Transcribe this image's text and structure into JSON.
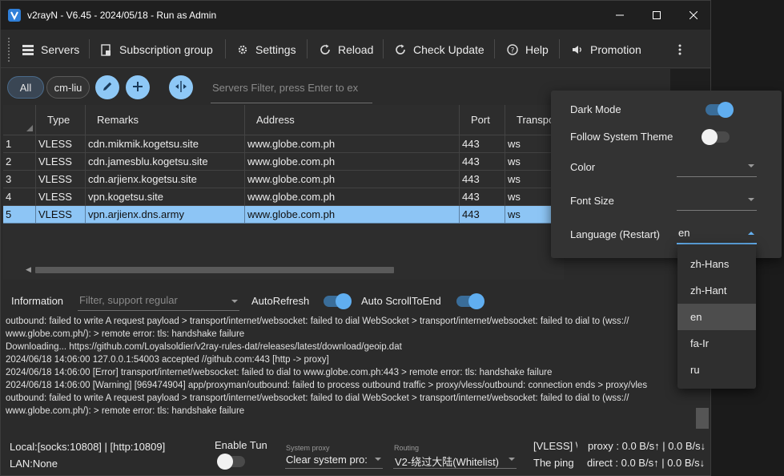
{
  "window": {
    "title": "v2rayN - V6.45 - 2024/05/18 - Run as Admin"
  },
  "toolbar": {
    "servers": "Servers",
    "subscription": "Subscription group",
    "settings": "Settings",
    "reload": "Reload",
    "check_update": "Check Update",
    "help": "Help",
    "promotion": "Promotion"
  },
  "filters": {
    "chip_all": "All",
    "chip_group": "cm-liu",
    "server_filter_placeholder": "Servers Filter, press Enter to ex"
  },
  "grid": {
    "columns": [
      "Type",
      "Remarks",
      "Address",
      "Port",
      "Transpo"
    ],
    "rows": [
      {
        "n": "1",
        "type": "VLESS",
        "remarks": "cdn.mikmik.kogetsu.site",
        "address": "www.globe.com.ph",
        "port": "443",
        "transport": "ws",
        "selected": false
      },
      {
        "n": "2",
        "type": "VLESS",
        "remarks": "cdn.jamesblu.kogetsu.site",
        "address": "www.globe.com.ph",
        "port": "443",
        "transport": "ws",
        "selected": false
      },
      {
        "n": "3",
        "type": "VLESS",
        "remarks": "cdn.arjienx.kogetsu.site",
        "address": "www.globe.com.ph",
        "port": "443",
        "transport": "ws",
        "selected": false
      },
      {
        "n": "4",
        "type": "VLESS",
        "remarks": "vpn.kogetsu.site",
        "address": "www.globe.com.ph",
        "port": "443",
        "transport": "ws",
        "selected": false
      },
      {
        "n": "5",
        "type": "VLESS",
        "remarks": "vpn.arjienx.dns.army",
        "address": "www.globe.com.ph",
        "port": "443",
        "transport": "ws",
        "selected": true
      }
    ]
  },
  "info": {
    "label": "Information",
    "filter_placeholder": "Filter, support regular",
    "autorefresh": "AutoRefresh",
    "autoscroll": "Auto ScrollToEnd"
  },
  "log_lines": [
    "outbound: failed to write A request payload > transport/internet/websocket: failed to dial WebSocket > transport/internet/websocket: failed to dial to (wss://",
    "www.globe.com.ph/):  > remote error: tls: handshake failure",
    "Downloading...   https://github.com/Loyalsoldier/v2ray-rules-dat/releases/latest/download/geoip.dat",
    "2024/06/18 14:06:00 127.0.0.1:54003 accepted //github.com:443 [http -> proxy]",
    "2024/06/18 14:06:00 [Error] transport/internet/websocket: failed to dial to www.globe.com.ph:443 > remote error: tls: handshake failure",
    "2024/06/18 14:06:00 [Warning] [969474904] app/proxyman/outbound: failed to process outbound traffic > proxy/vless/outbound: connection ends > proxy/vles",
    "outbound: failed to write A request payload > transport/internet/websocket: failed to dial WebSocket > transport/internet/websocket: failed to dial to (wss://",
    "www.globe.com.ph/):  > remote error: tls: handshake failure"
  ],
  "status": {
    "local": "Local:[socks:10808] | [http:10809]",
    "lan": "LAN:None",
    "enable_tun": "Enable Tun",
    "system_proxy_label": "System proxy",
    "system_proxy_value": "Clear system pro:",
    "routing_label": "Routing",
    "routing_value": "V2-绕过大陆(Whitelist)",
    "vless_info": "[VLESS] \\",
    "ping_info": "The ping",
    "proxy_speed": "proxy : 0.0 B/s↑ | 0.0 B/s↓",
    "direct_speed": "direct : 0.0 B/s↑ | 0.0 B/s↓"
  },
  "settings_panel": {
    "dark_mode": "Dark Mode",
    "follow_system": "Follow System Theme",
    "color": "Color",
    "font_size": "Font Size",
    "language": "Language (Restart)",
    "language_value": "en"
  },
  "language_options": [
    "zh-Hans",
    "zh-Hant",
    "en",
    "fa-Ir",
    "ru"
  ],
  "colors": {
    "accent": "#60aef0",
    "selected_row": "#8dc5f5",
    "round_button": "#8ec8f6"
  }
}
